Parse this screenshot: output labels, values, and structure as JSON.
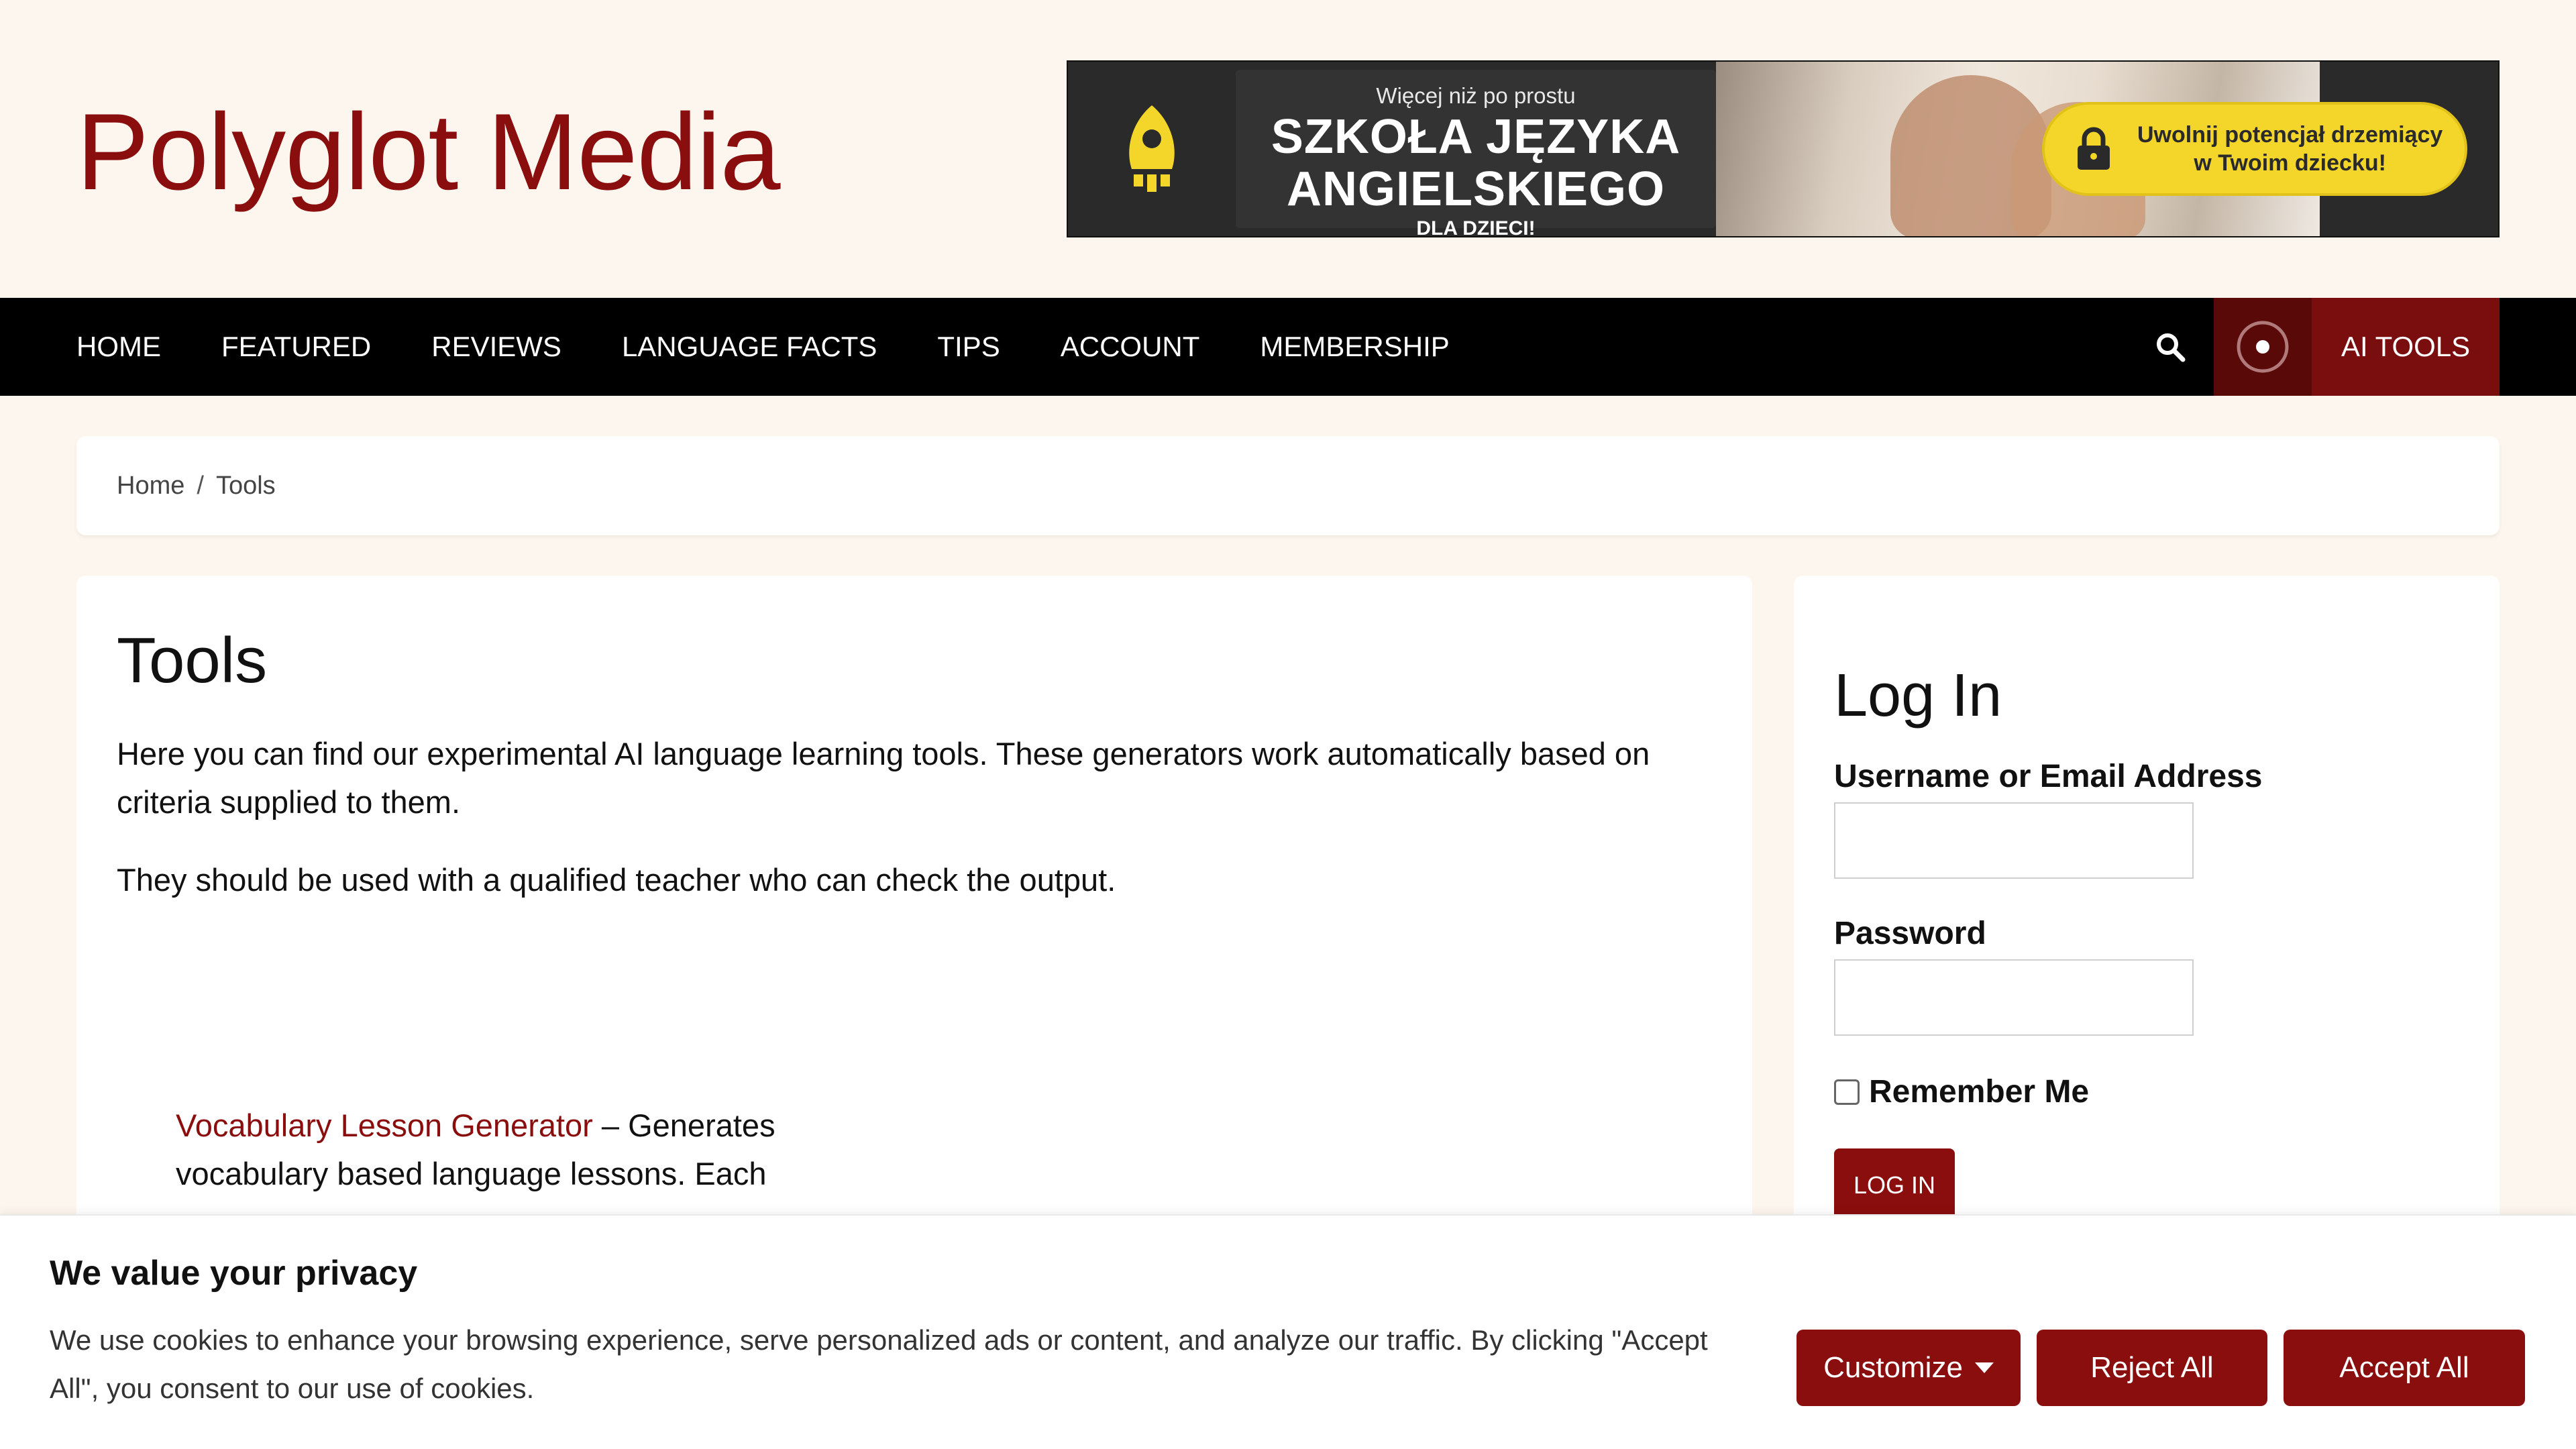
{
  "site": {
    "title": "Polyglot Media"
  },
  "ad": {
    "kicker": "Więcej niż po prostu",
    "headline_line1": "SZKOŁA JĘZYKA",
    "headline_line2": "ANGIELSKIEGO",
    "sub": "DLA DZIECI!",
    "cta_line1": "Uwolnij potencjał drzemiący",
    "cta_line2": "w Twoim dziecku!",
    "accent_color": "#f3d629"
  },
  "nav": {
    "items": [
      {
        "label": "HOME"
      },
      {
        "label": "FEATURED"
      },
      {
        "label": "REVIEWS"
      },
      {
        "label": "LANGUAGE FACTS"
      },
      {
        "label": "TIPS"
      },
      {
        "label": "ACCOUNT"
      },
      {
        "label": "MEMBERSHIP"
      }
    ],
    "search_icon": "search-icon",
    "ai_icon": "record-icon",
    "ai_label": "AI TOOLS",
    "ai_color": "#7a0e0e"
  },
  "breadcrumb": {
    "home": "Home",
    "separator": "/",
    "current": "Tools"
  },
  "main": {
    "title": "Tools",
    "intro_1": "Here you can find our experimental AI language learning tools. These generators work automatically based on criteria supplied to them.",
    "intro_2": "They should be used with a qualified teacher who can check the output.",
    "tools": [
      {
        "link": "Vocabulary Lesson Generator",
        "description_line1": " – Generates",
        "description_line2": "vocabulary based language lessons. Each"
      }
    ]
  },
  "login": {
    "title": "Log In",
    "username_label": "Username or Email Address",
    "username_value": "",
    "password_label": "Password",
    "password_value": "",
    "remember_label": "Remember Me",
    "button": "LOG IN"
  },
  "cookie": {
    "title": "We value your privacy",
    "text": "We use cookies to enhance your browsing experience, serve personalized ads or content, and analyze our traffic. By clicking \"Accept All\", you consent to our use of cookies.",
    "customize": "Customize",
    "reject": "Reject All",
    "accept": "Accept All",
    "button_color": "#8b0e0e"
  }
}
